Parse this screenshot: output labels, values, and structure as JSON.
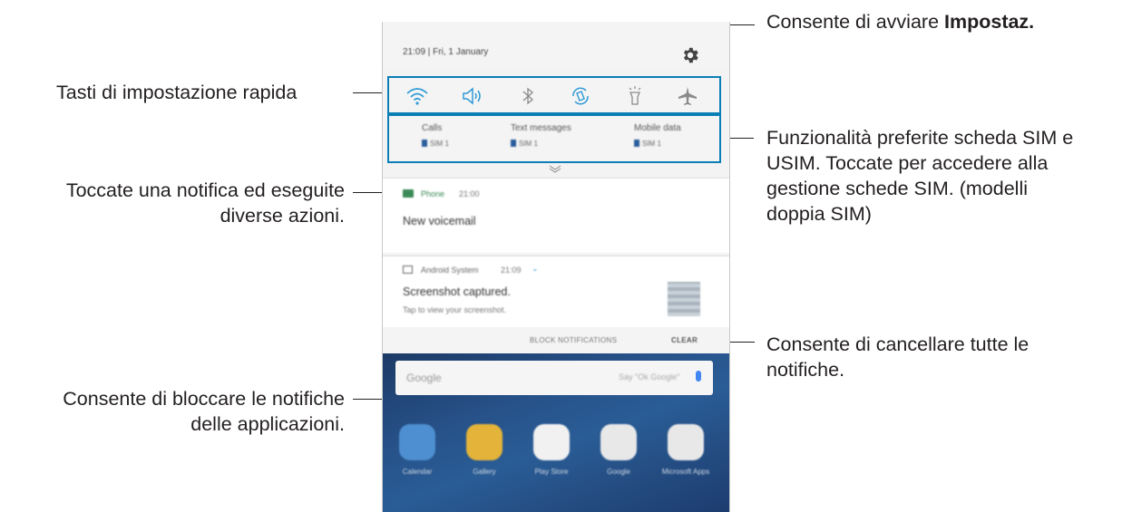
{
  "callouts": {
    "settings_prefix": "Consente di avviare ",
    "settings_bold": "Impostaz.",
    "quick_settings": "Tasti di impostazione rapida",
    "sim_line1": "Funzionalità preferite scheda SIM e",
    "sim_line2": "USIM. Toccate per accedere alla",
    "sim_line3": "gestione schede SIM. (modelli",
    "sim_line4": "doppia SIM)",
    "notif_line1": "Toccate una notifica ed eseguite",
    "notif_line2": "diverse azioni.",
    "clear_line1": "Consente di cancellare tutte le",
    "clear_line2": "notifiche.",
    "block_line1": "Consente di bloccare le notifiche",
    "block_line2": "delle applicazioni."
  },
  "phone": {
    "status": {
      "time_date": "21:09  |  Fri, 1 January"
    },
    "quick_icons": [
      "wifi-icon",
      "sound-icon",
      "bluetooth-icon",
      "auto-rotate-icon",
      "flashlight-icon",
      "airplane-mode-icon"
    ],
    "sim_cards": [
      {
        "label": "Calls",
        "sim": "SIM 1"
      },
      {
        "label": "Text messages",
        "sim": "SIM 1"
      },
      {
        "label": "Mobile data",
        "sim": "SIM 1"
      }
    ],
    "notification1": {
      "app": "Phone",
      "time": "21:00",
      "title": "New voicemail"
    },
    "notification2": {
      "app": "Android System",
      "time": "21:09",
      "title": "Screenshot captured.",
      "text": "Tap to view your screenshot."
    },
    "actions": {
      "block": "BLOCK NOTIFICATIONS",
      "clear": "CLEAR"
    },
    "home": {
      "search_logo": "Google",
      "search_hint": "Say \"Ok Google\"",
      "apps": [
        "Calendar",
        "Gallery",
        "Play Store",
        "Google",
        "Microsoft Apps"
      ]
    }
  },
  "colors": {
    "highlight": "#0b7fb5",
    "wallpaper": "#27528a"
  }
}
